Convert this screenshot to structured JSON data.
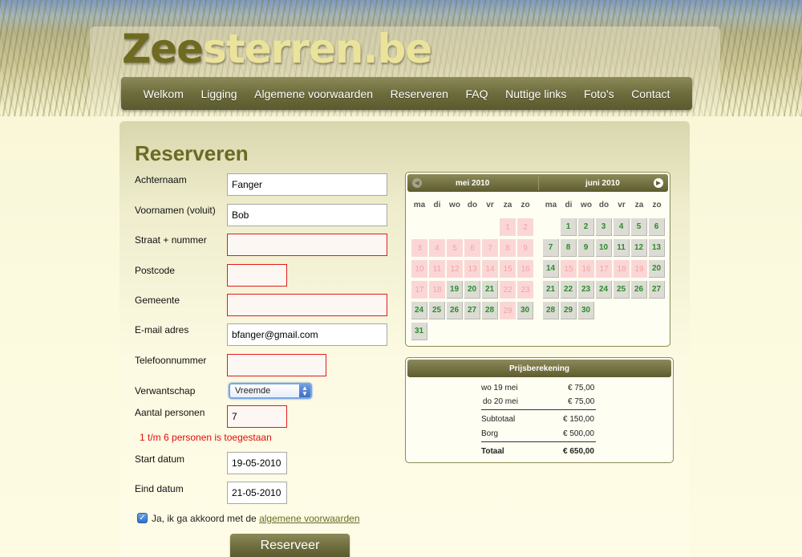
{
  "site": {
    "logo_part1": "Zee",
    "logo_part2": "sterren.be"
  },
  "nav": [
    "Welkom",
    "Ligging",
    "Algemene voorwaarden",
    "Reserveren",
    "FAQ",
    "Nuttige links",
    "Foto's",
    "Contact"
  ],
  "page": {
    "title": "Reserveren"
  },
  "form": {
    "achternaam": {
      "label": "Achternaam",
      "value": "Fanger"
    },
    "voornamen": {
      "label": "Voornamen (voluit)",
      "value": "Bob"
    },
    "straat": {
      "label": "Straat + nummer",
      "value": ""
    },
    "postcode": {
      "label": "Postcode",
      "value": ""
    },
    "gemeente": {
      "label": "Gemeente",
      "value": ""
    },
    "email": {
      "label": "E-mail adres",
      "value": "bfanger@gmail.com"
    },
    "telefoon": {
      "label": "Telefoonnummer",
      "value": ""
    },
    "verwantschap": {
      "label": "Verwantschap",
      "value": "Vreemde"
    },
    "personen": {
      "label": "Aantal personen",
      "value": "7",
      "error": "1 t/m 6 personen is toegestaan"
    },
    "start": {
      "label": "Start datum",
      "value": "19-05-2010"
    },
    "eind": {
      "label": "Eind datum",
      "value": "21-05-2010"
    },
    "agree_text": "Ja, ik ga akkoord met de",
    "agree_link": "algemene voorwaarden",
    "submit_label": "Reserveer"
  },
  "calendar": {
    "month1": "mei 2010",
    "month2": "juni  2010",
    "weekdays": [
      "ma",
      "di",
      "wo",
      "do",
      "vr",
      "za",
      "zo"
    ],
    "mei": [
      {
        "d": "1",
        "s": "taken"
      },
      {
        "d": "2",
        "s": "taken"
      },
      {
        "d": "3",
        "s": "taken"
      },
      {
        "d": "4",
        "s": "taken"
      },
      {
        "d": "5",
        "s": "taken"
      },
      {
        "d": "6",
        "s": "taken"
      },
      {
        "d": "7",
        "s": "taken"
      },
      {
        "d": "8",
        "s": "taken"
      },
      {
        "d": "9",
        "s": "taken"
      },
      {
        "d": "10",
        "s": "taken"
      },
      {
        "d": "11",
        "s": "taken"
      },
      {
        "d": "12",
        "s": "taken"
      },
      {
        "d": "13",
        "s": "taken"
      },
      {
        "d": "14",
        "s": "taken"
      },
      {
        "d": "15",
        "s": "taken"
      },
      {
        "d": "16",
        "s": "taken"
      },
      {
        "d": "17",
        "s": "taken"
      },
      {
        "d": "18",
        "s": "taken"
      },
      {
        "d": "19",
        "s": "avail"
      },
      {
        "d": "20",
        "s": "avail"
      },
      {
        "d": "21",
        "s": "avail"
      },
      {
        "d": "22",
        "s": "taken"
      },
      {
        "d": "23",
        "s": "taken"
      },
      {
        "d": "24",
        "s": "avail"
      },
      {
        "d": "25",
        "s": "avail"
      },
      {
        "d": "26",
        "s": "avail"
      },
      {
        "d": "27",
        "s": "avail"
      },
      {
        "d": "28",
        "s": "avail"
      },
      {
        "d": "29",
        "s": "taken"
      },
      {
        "d": "30",
        "s": "avail"
      },
      {
        "d": "31",
        "s": "avail"
      }
    ],
    "juni": [
      {
        "d": "1",
        "s": "avail"
      },
      {
        "d": "2",
        "s": "avail"
      },
      {
        "d": "3",
        "s": "avail"
      },
      {
        "d": "4",
        "s": "avail"
      },
      {
        "d": "5",
        "s": "avail"
      },
      {
        "d": "6",
        "s": "avail"
      },
      {
        "d": "7",
        "s": "avail"
      },
      {
        "d": "8",
        "s": "avail"
      },
      {
        "d": "9",
        "s": "avail"
      },
      {
        "d": "10",
        "s": "avail"
      },
      {
        "d": "11",
        "s": "avail"
      },
      {
        "d": "12",
        "s": "avail"
      },
      {
        "d": "13",
        "s": "avail"
      },
      {
        "d": "14",
        "s": "avail"
      },
      {
        "d": "15",
        "s": "taken"
      },
      {
        "d": "16",
        "s": "taken"
      },
      {
        "d": "17",
        "s": "taken"
      },
      {
        "d": "18",
        "s": "taken"
      },
      {
        "d": "19",
        "s": "taken"
      },
      {
        "d": "20",
        "s": "avail"
      },
      {
        "d": "21",
        "s": "avail"
      },
      {
        "d": "22",
        "s": "avail"
      },
      {
        "d": "23",
        "s": "avail"
      },
      {
        "d": "24",
        "s": "avail"
      },
      {
        "d": "25",
        "s": "avail"
      },
      {
        "d": "26",
        "s": "avail"
      },
      {
        "d": "27",
        "s": "avail"
      },
      {
        "d": "28",
        "s": "avail"
      },
      {
        "d": "29",
        "s": "avail"
      },
      {
        "d": "30",
        "s": "avail"
      }
    ]
  },
  "price": {
    "title": "Prijsberekening",
    "rows": [
      {
        "label": "wo 19 mei",
        "amount": "€ 75,00"
      },
      {
        "label": "do 20 mei",
        "amount": "€ 75,00"
      }
    ],
    "subtotal_label": "Subtotaal",
    "subtotal": "€ 150,00",
    "borg_label": "Borg",
    "borg": "€ 500,00",
    "total_label": "Totaal",
    "total": "€ 650,00"
  }
}
